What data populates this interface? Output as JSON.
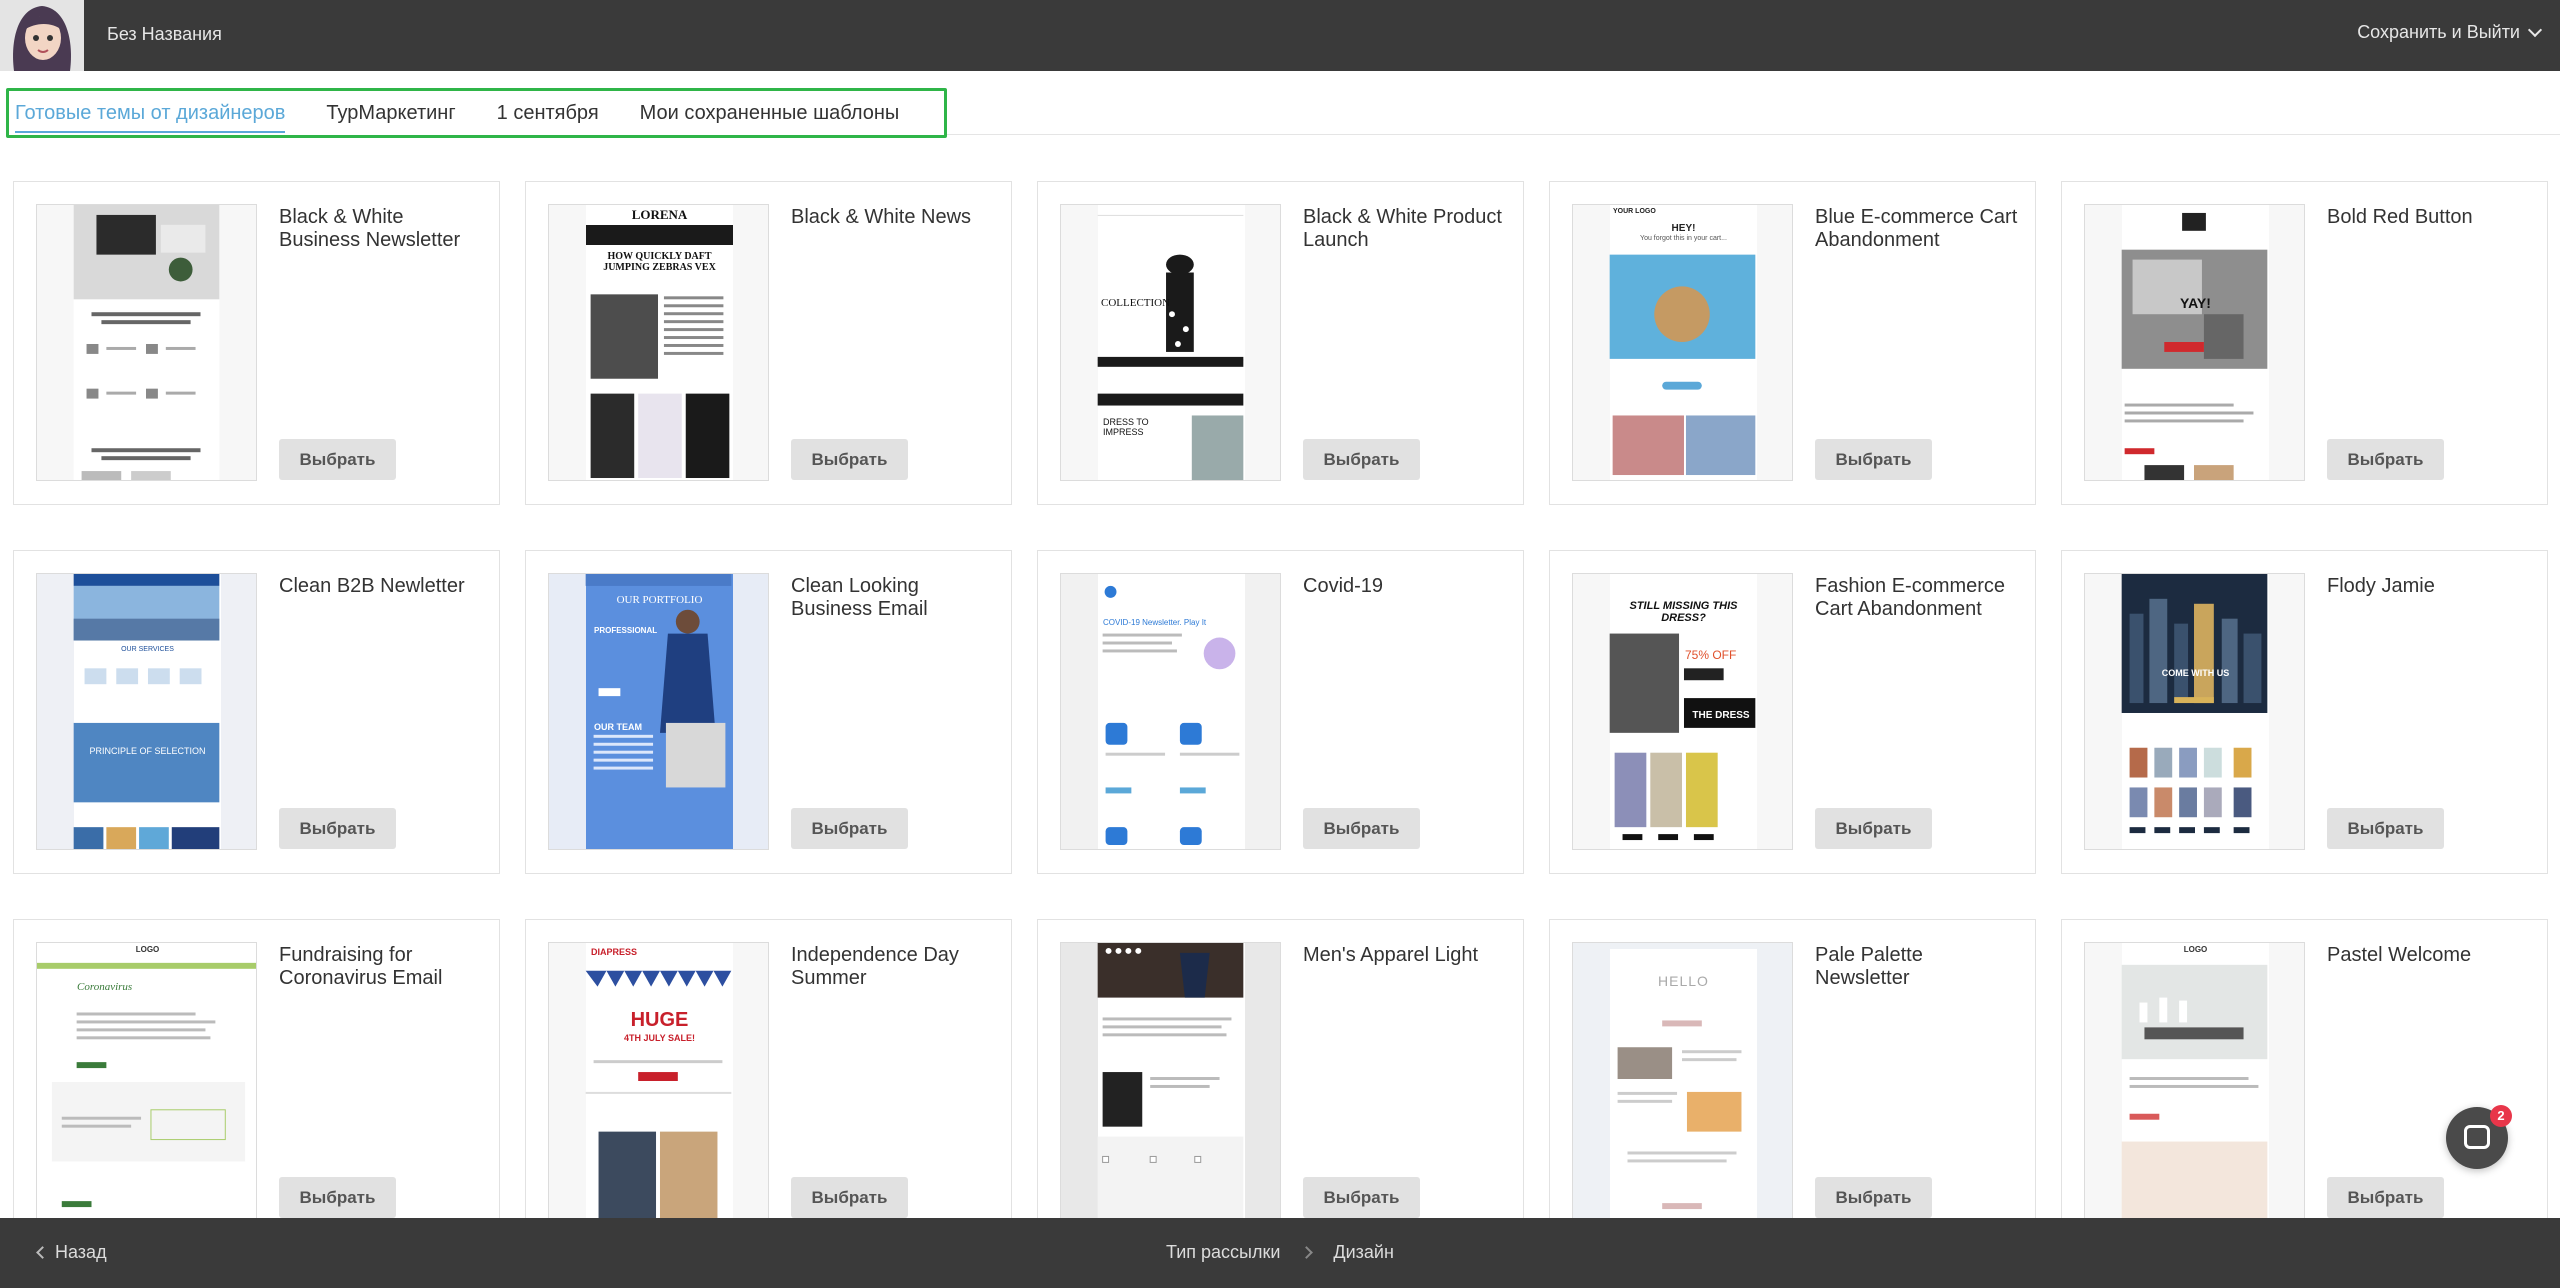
{
  "header": {
    "doc_title": "Без Названия",
    "save_exit": "Сохранить и Выйти"
  },
  "tabs": [
    {
      "label": "Готовые темы от дизайнеров",
      "active": true
    },
    {
      "label": "ТурМаркетинг",
      "active": false
    },
    {
      "label": "1 сентября",
      "active": false
    },
    {
      "label": "Мои сохраненные шаблоны",
      "active": false
    }
  ],
  "choose_label": "Выбрать",
  "templates": [
    {
      "title": "Black & White Business Newsletter"
    },
    {
      "title": "Black & White News"
    },
    {
      "title": "Black & White Product Launch"
    },
    {
      "title": "Blue E-commerce Cart Abandonment"
    },
    {
      "title": "Bold Red Button"
    },
    {
      "title": "Clean B2B Newletter"
    },
    {
      "title": "Clean Looking Business Email"
    },
    {
      "title": "Covid-19"
    },
    {
      "title": "Fashion E-commerce Cart Abandonment"
    },
    {
      "title": "Flody Jamie"
    },
    {
      "title": "Fundraising for Coronavirus Email"
    },
    {
      "title": "Independence Day Summer"
    },
    {
      "title": "Men's Apparel Light"
    },
    {
      "title": "Pale Palette Newsletter"
    },
    {
      "title": "Pastel Welcome"
    }
  ],
  "thumb_text": {
    "lorena": "LORENA",
    "zebras": "HOW QUICKLY DAFT JUMPING ZEBRAS VEX",
    "collection": "COLLECTION",
    "dress_impress": "DRESS TO IMPRESS",
    "your_logo": "YOUR LOGO",
    "hey": "HEY!",
    "forgot": "You forgot this in your cart...",
    "yay": "YAY!",
    "our_services": "OUR SERVICES",
    "principle": "PRINCIPLE OF SELECTION",
    "our_portfolio": "OUR PORTFOLIO",
    "professional": "PROFESSIONAL",
    "our_team": "OUR TEAM",
    "covid_title": "COVID-19 Newsletter. Play It",
    "still_missing": "STILL MISSING THIS DRESS?",
    "off": "75% OFF",
    "the_dress": "THE DRESS",
    "come_with_us": "COME WITH US",
    "coronavirus": "Coronavirus",
    "diapress": "DIAPRESS",
    "huge": "HUGE",
    "july_sale": "4TH JULY SALE!",
    "hello": "HELLO",
    "logo": "LOGO"
  },
  "footer": {
    "back": "Назад",
    "step1": "Тип рассылки",
    "step2": "Дизайн"
  },
  "chat": {
    "badge": "2"
  },
  "colors": {
    "accent": "#5ba8d8",
    "highlight": "#2fb548",
    "bar": "#3a3a3a",
    "badge": "#e8364a"
  }
}
